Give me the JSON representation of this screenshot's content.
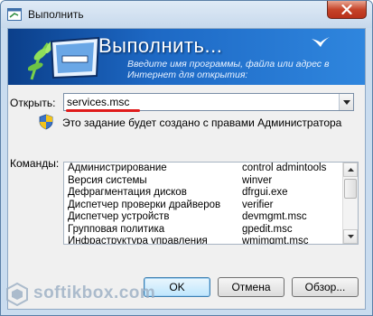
{
  "window": {
    "title": "Выполнить",
    "close_icon": "close-icon"
  },
  "banner": {
    "title": "Выполнить...",
    "description": "Введите имя программы, файла или адрес в Интернет для открытия:",
    "art": [
      "monitor-plant-icon",
      "bird-icon"
    ]
  },
  "open": {
    "label": "Открыть:",
    "value": "services.msc",
    "highlight_color": "#e01b1b"
  },
  "admin_notice": "Это задание будет создано с правами Администратора",
  "commands": {
    "label": "Команды:",
    "rows": [
      {
        "name": "Администрирование",
        "exe": "control admintools"
      },
      {
        "name": "Версия системы",
        "exe": "winver"
      },
      {
        "name": "Дефрагментация дисков",
        "exe": "dfrgui.exe"
      },
      {
        "name": "Диспетчер проверки драйверов",
        "exe": "verifier"
      },
      {
        "name": "Диспетчер устройств",
        "exe": "devmgmt.msc"
      },
      {
        "name": "Групповая политика",
        "exe": "gpedit.msc"
      },
      {
        "name": "Инфраструктура управления",
        "exe": "wmimgmt.msc"
      }
    ]
  },
  "buttons": {
    "ok": "OK",
    "cancel": "Отмена",
    "browse": "Обзор..."
  },
  "watermark": "softikbox.com",
  "colors": {
    "banner_dark": "#0b3f8a",
    "banner_light": "#2f86de",
    "close_red": "#c6452a"
  }
}
